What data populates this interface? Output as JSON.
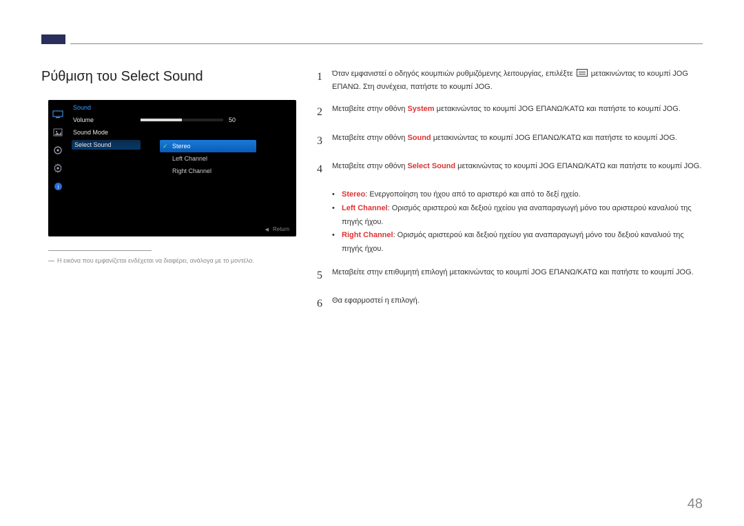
{
  "header": {
    "title": "Ρύθμιση του Select Sound"
  },
  "osd": {
    "title": "Sound",
    "items": {
      "volume_label": "Volume",
      "volume_value": "50",
      "sound_mode_label": "Sound Mode",
      "select_sound_label": "Select Sound"
    },
    "submenu": {
      "stereo": "Stereo",
      "left": "Left Channel",
      "right": "Right Channel"
    },
    "return": "Return"
  },
  "note": "Η εικόνα που εμφανίζεται ενδέχεται να διαφέρει, ανάλογα με το μοντέλο.",
  "steps": {
    "s1a": "Όταν εμφανιστεί ο οδηγός κουμπιών ρυθμιζόμενης λειτουργίας, επιλέξτε ",
    "s1b": " μετακινώντας το κουμπί JOG ΕΠΑΝΩ. Στη συνέχεια, πατήστε το κουμπί JOG.",
    "s2a": "Μεταβείτε στην οθόνη ",
    "s2_hl": "System",
    "s2b": " μετακινώντας το κουμπί JOG ΕΠΑΝΩ/ΚΑΤΩ και πατήστε το κουμπί JOG.",
    "s3a": "Μεταβείτε στην οθόνη ",
    "s3_hl": "Sound",
    "s3b": " μετακινώντας το κουμπί JOG ΕΠΑΝΩ/ΚΑΤΩ και πατήστε το κουμπί JOG.",
    "s4a": "Μεταβείτε στην οθόνη ",
    "s4_hl": "Select Sound",
    "s4b": " μετακινώντας το κουμπί JOG ΕΠΑΝΩ/ΚΑΤΩ και πατήστε το κουμπί JOG.",
    "b1_hl": "Stereo",
    "b1": ": Ενεργοποίηση του ήχου από το αριστερό και από το δεξί ηχείο.",
    "b2_hl": "Left Channel",
    "b2": ": Ορισμός αριστερού και δεξιού ηχείου για αναπαραγωγή μόνο του αριστερού καναλιού της πηγής ήχου.",
    "b3_hl": "Right Channel",
    "b3": ": Ορισμός αριστερού και δεξιού ηχείου για αναπαραγωγή μόνο του δεξιού καναλιού της πηγής ήχου.",
    "s5": "Μεταβείτε στην επιθυμητή επιλογή μετακινώντας το κουμπί JOG ΕΠΑΝΩ/ΚΑΤΩ και πατήστε το κουμπί JOG.",
    "s6": "Θα εφαρμοστεί η επιλογή."
  },
  "nums": {
    "n1": "1",
    "n2": "2",
    "n3": "3",
    "n4": "4",
    "n5": "5",
    "n6": "6"
  },
  "page_number": "48"
}
